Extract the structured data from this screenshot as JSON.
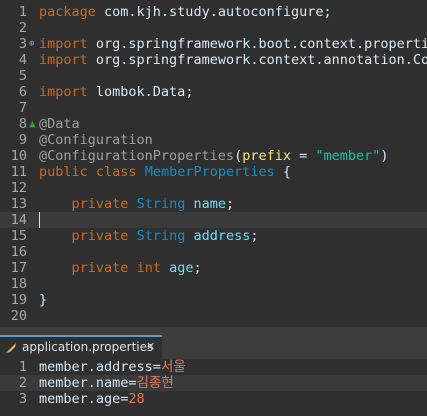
{
  "java_editor": {
    "lines": [
      {
        "n": "1",
        "parts": [
          [
            "kw",
            "package"
          ],
          [
            "ident",
            " com.kjh.study.autoconfigure;"
          ]
        ]
      },
      {
        "n": "2",
        "parts": []
      },
      {
        "n": "3",
        "marker": "⊕",
        "parts": [
          [
            "kw",
            "import"
          ],
          [
            "ident",
            " org.springframework.boot.context.properties"
          ]
        ]
      },
      {
        "n": "4",
        "parts": [
          [
            "kw",
            "import"
          ],
          [
            "ident",
            " org.springframework.context.annotation.Con"
          ]
        ]
      },
      {
        "n": "5",
        "parts": []
      },
      {
        "n": "6",
        "parts": [
          [
            "kw",
            "import"
          ],
          [
            "ident",
            " lombok.Data;"
          ]
        ]
      },
      {
        "n": "7",
        "parts": []
      },
      {
        "n": "8",
        "marker": "▲",
        "parts": [
          [
            "ann",
            "@Data"
          ]
        ]
      },
      {
        "n": "9",
        "parts": [
          [
            "ann",
            "@Configuration"
          ]
        ]
      },
      {
        "n": "10",
        "parts": [
          [
            "ann",
            "@ConfigurationProperties"
          ],
          [
            "ident",
            "("
          ],
          [
            "red",
            "prefix"
          ],
          [
            "ident",
            " = "
          ],
          [
            "str",
            "\"member\""
          ],
          [
            "ident",
            ")"
          ]
        ]
      },
      {
        "n": "11",
        "parts": [
          [
            "kw",
            "public"
          ],
          [
            "ident",
            " "
          ],
          [
            "kw",
            "class"
          ],
          [
            "ident",
            " "
          ],
          [
            "cls",
            "MemberProperties"
          ],
          [
            "ident",
            " {"
          ]
        ]
      },
      {
        "n": "12",
        "parts": []
      },
      {
        "n": "13",
        "parts": [
          [
            "ident",
            "    "
          ],
          [
            "kw",
            "private"
          ],
          [
            "ident",
            " "
          ],
          [
            "cls",
            "String"
          ],
          [
            "ident",
            " "
          ],
          [
            "field",
            "name"
          ],
          [
            "ident",
            ";"
          ]
        ]
      },
      {
        "n": "14",
        "current": true,
        "parts": []
      },
      {
        "n": "15",
        "parts": [
          [
            "ident",
            "    "
          ],
          [
            "kw",
            "private"
          ],
          [
            "ident",
            " "
          ],
          [
            "cls",
            "String"
          ],
          [
            "ident",
            " "
          ],
          [
            "field",
            "address"
          ],
          [
            "ident",
            ";"
          ]
        ]
      },
      {
        "n": "16",
        "parts": []
      },
      {
        "n": "17",
        "parts": [
          [
            "ident",
            "    "
          ],
          [
            "kw",
            "private"
          ],
          [
            "ident",
            " "
          ],
          [
            "kw",
            "int"
          ],
          [
            "ident",
            " "
          ],
          [
            "field",
            "age"
          ],
          [
            "ident",
            ";"
          ]
        ]
      },
      {
        "n": "18",
        "parts": []
      },
      {
        "n": "19",
        "parts": [
          [
            "ident",
            "}"
          ]
        ]
      },
      {
        "n": "20",
        "parts": []
      }
    ]
  },
  "tab": {
    "label": "application.properties",
    "icon": "properties-file-icon",
    "close_symbol": "✕"
  },
  "properties_editor": {
    "lines": [
      {
        "n": "1",
        "key": "member.address",
        "eq": "=",
        "value": "서울"
      },
      {
        "n": "2",
        "key": "member.name",
        "eq": "=",
        "value": "김종현",
        "current": true
      },
      {
        "n": "3",
        "key": "member.age",
        "eq": "=",
        "value": "28"
      }
    ]
  },
  "colors": {
    "background": "#2f2f2f",
    "keyword": "#cc6c1d",
    "annotation": "#a0a0a0",
    "string": "#17c6a3",
    "class_type": "#1290c3",
    "field": "#66e1f8",
    "property_value": "#e07a5f"
  }
}
